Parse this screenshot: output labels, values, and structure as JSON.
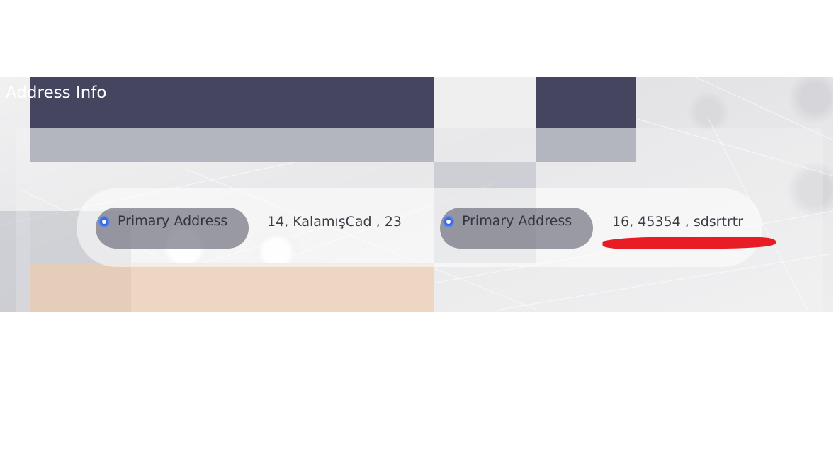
{
  "section": {
    "title": "Address Info"
  },
  "addresses": [
    {
      "type_label": "Primary Address",
      "value": "14, KalamışCad , 23",
      "selected": true
    },
    {
      "type_label": "Primary Address",
      "value": "16, 45354 , sdsrtrtr",
      "selected": true,
      "annotated": true
    }
  ],
  "colors": {
    "title_text": "#ffffff",
    "radio_accent": "#3f6bd6",
    "annotation": "#e81c24",
    "header_block": "#454560"
  },
  "icons": {
    "radio": "radio-selected-icon",
    "annotation": "red-underline-annotation"
  }
}
